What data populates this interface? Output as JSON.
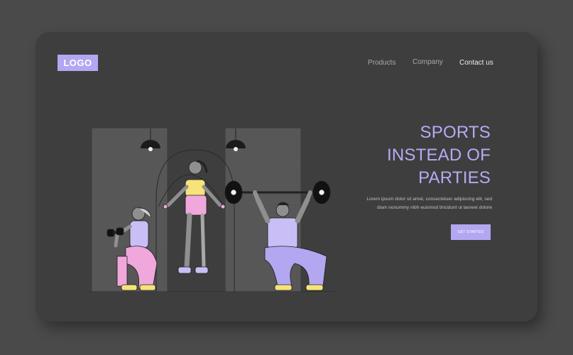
{
  "logo": {
    "text": "LOGO"
  },
  "nav": {
    "products": "Products",
    "company": "Company",
    "contact": "Contact us"
  },
  "hero": {
    "headline_1": "SPORTS",
    "headline_2": "INSTEAD OF",
    "headline_3": "PARTIES",
    "body_line_1": "Lorem ipsum dolor sit amet, consectetuer adipiscing elit, sed",
    "body_line_2": "diam nonummy nibh euismod tincidunt ut laoreet dolore",
    "cta": "GET STARTED"
  },
  "colors": {
    "page_bg": "#4a4a4a",
    "card_bg": "#3e3e3e",
    "accent": "#b3a7f1",
    "skin": "#8f8f8f",
    "pink": "#f0a8dc",
    "yellow": "#f6e37a",
    "lavender": "#c9bff6"
  }
}
